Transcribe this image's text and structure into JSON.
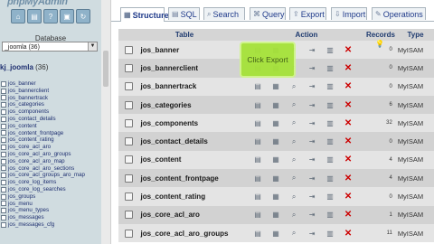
{
  "left": {
    "logo": "phpMyAdmin",
    "icons": [
      "home-icon",
      "sql-query-icon",
      "help-icon",
      "docs-icon",
      "reload-icon"
    ],
    "db_label": "Database",
    "db_select": "_joomla (36)",
    "db_title": "kj_joomla",
    "db_count": "(36)",
    "tables": [
      "jos_banner",
      "jos_bannerclient",
      "jos_bannertrack",
      "jos_categories",
      "jos_components",
      "jos_contact_details",
      "jos_content",
      "jos_content_frontpage",
      "jos_content_rating",
      "jos_core_acl_aro",
      "jos_core_acl_aro_groups",
      "jos_core_acl_aro_map",
      "jos_core_acl_aro_sections",
      "jos_core_acl_groups_aro_map",
      "jos_core_log_items",
      "jos_core_log_searches",
      "jos_groups",
      "jos_menu",
      "jos_menu_types",
      "jos_messages",
      "jos_messages_cfg"
    ]
  },
  "tabs": [
    {
      "label": "Structure",
      "icon": "structure-icon"
    },
    {
      "label": "SQL",
      "icon": "sql-icon"
    },
    {
      "label": "Search",
      "icon": "search-icon"
    },
    {
      "label": "Query",
      "icon": "query-icon"
    },
    {
      "label": "Export",
      "icon": "export-icon"
    },
    {
      "label": "Import",
      "icon": "import-icon"
    },
    {
      "label": "Operations",
      "icon": "operations-icon"
    }
  ],
  "headers": {
    "table": "Table",
    "action": "Action",
    "records": "Records",
    "type": "Type"
  },
  "rows": [
    {
      "name": "jos_banner",
      "records": "0",
      "type": "MyISAM"
    },
    {
      "name": "jos_bannerclient",
      "records": "0",
      "type": "MyISAM"
    },
    {
      "name": "jos_bannertrack",
      "records": "0",
      "type": "MyISAM"
    },
    {
      "name": "jos_categories",
      "records": "6",
      "type": "MyISAM"
    },
    {
      "name": "jos_components",
      "records": "32",
      "type": "MyISAM"
    },
    {
      "name": "jos_contact_details",
      "records": "0",
      "type": "MyISAM"
    },
    {
      "name": "jos_content",
      "records": "4",
      "type": "MyISAM"
    },
    {
      "name": "jos_content_frontpage",
      "records": "4",
      "type": "MyISAM"
    },
    {
      "name": "jos_content_rating",
      "records": "0",
      "type": "MyISAM"
    },
    {
      "name": "jos_core_acl_aro",
      "records": "1",
      "type": "MyISAM"
    },
    {
      "name": "jos_core_acl_aro_groups",
      "records": "11",
      "type": "MyISAM"
    }
  ],
  "tooltip": "Click Export"
}
